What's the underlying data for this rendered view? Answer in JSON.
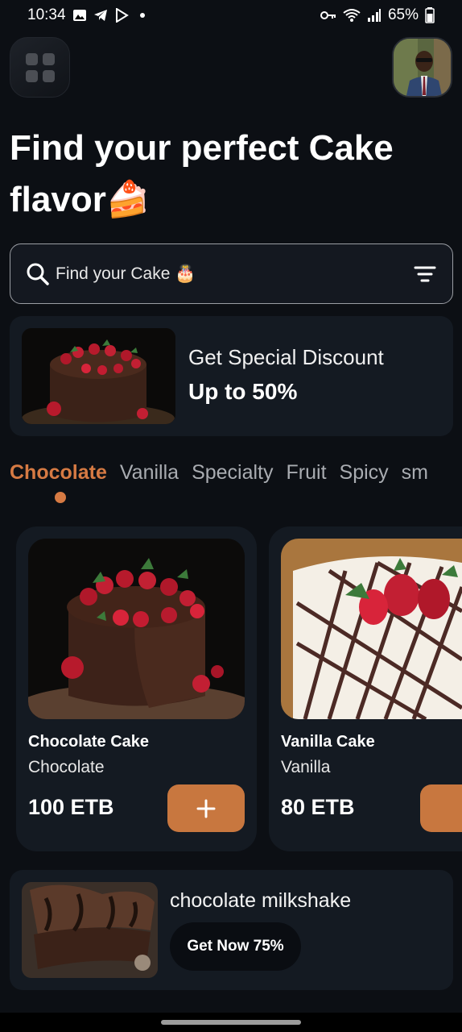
{
  "status_bar": {
    "time": "10:34",
    "battery": "65%"
  },
  "header": {
    "menu_icon": "grid-icon",
    "avatar_alt": ""
  },
  "title": {
    "line": "Find your perfect Cake flavor🍰"
  },
  "search": {
    "placeholder": "Find your Cake 🎂",
    "search_icon": "search-icon",
    "filter_icon": "filter-icon"
  },
  "promo": {
    "line1": "Get Special Discount",
    "line2": "Up to 50%"
  },
  "tabs": [
    {
      "label": "Chocolate",
      "active": true
    },
    {
      "label": "Vanilla",
      "active": false
    },
    {
      "label": "Specialty",
      "active": false
    },
    {
      "label": "Fruit",
      "active": false
    },
    {
      "label": "Spicy",
      "active": false
    },
    {
      "label": "sm",
      "active": false
    }
  ],
  "products": [
    {
      "name": "Chocolate Cake",
      "category": "Chocolate",
      "price": "100 ETB"
    },
    {
      "name": "Vanilla Cake",
      "category": "Vanilla",
      "price": "80 ETB"
    }
  ],
  "bottom_promo": {
    "title": "chocolate milkshake",
    "button": "Get Now 75%"
  },
  "colors": {
    "accent": "#d67a43",
    "background": "#0c0f14",
    "card": "#141a22"
  }
}
